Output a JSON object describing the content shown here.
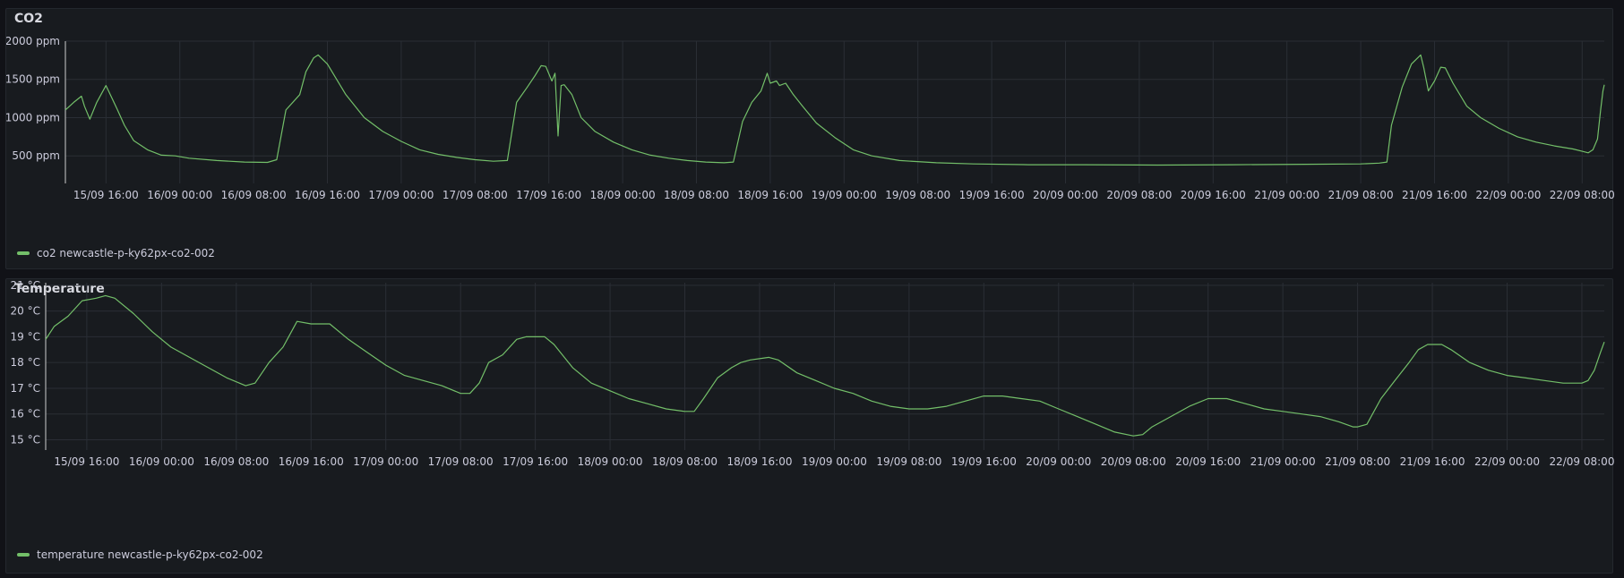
{
  "colors": {
    "series": "#73bf69",
    "grid": "#2a2e35",
    "axis_text": "#ccccdc"
  },
  "panels": {
    "co2": {
      "title": "CO2",
      "legend": "co2 newcastle-p-ky62px-co2-002"
    },
    "temperature": {
      "title": "Temperature",
      "legend": "temperature newcastle-p-ky62px-co2-002"
    }
  },
  "chart_data": [
    {
      "type": "line",
      "title": "CO2",
      "xlabel": "",
      "ylabel": "",
      "ylim": [
        140,
        2000
      ],
      "y_ticks": [
        "500 ppm",
        "1000 ppm",
        "1500 ppm",
        "2000 ppm"
      ],
      "y_tick_values": [
        500,
        1000,
        1500,
        2000
      ],
      "x_range": [
        "15/09 11:36",
        "22/09 10:24"
      ],
      "x_ticks": [
        "15/09 16:00",
        "16/09 00:00",
        "16/09 08:00",
        "16/09 16:00",
        "17/09 00:00",
        "17/09 08:00",
        "17/09 16:00",
        "18/09 00:00",
        "18/09 08:00",
        "18/09 16:00",
        "19/09 00:00",
        "19/09 08:00",
        "19/09 16:00",
        "20/09 00:00",
        "20/09 08:00",
        "20/09 16:00",
        "21/09 00:00",
        "21/09 08:00",
        "21/09 16:00",
        "22/09 00:00",
        "22/09 08:00"
      ],
      "grid": true,
      "legend": "bottom-left",
      "series": [
        {
          "name": "co2 newcastle-p-ky62px-co2-002",
          "points": [
            [
              "15/09 11:36",
              1100
            ],
            [
              "15/09 12:30",
              1200
            ],
            [
              "15/09 13:20",
              1280
            ],
            [
              "15/09 13:40",
              1150
            ],
            [
              "15/09 14:15",
              980
            ],
            [
              "15/09 15:00",
              1200
            ],
            [
              "15/09 16:00",
              1420
            ],
            [
              "15/09 16:40",
              1250
            ],
            [
              "15/09 17:15",
              1100
            ],
            [
              "15/09 18:00",
              900
            ],
            [
              "15/09 19:00",
              700
            ],
            [
              "15/09 20:30",
              580
            ],
            [
              "15/09 22:00",
              510
            ],
            [
              "15/09 23:30",
              500
            ],
            [
              "16/09 01:00",
              470
            ],
            [
              "16/09 04:00",
              440
            ],
            [
              "16/09 07:00",
              420
            ],
            [
              "16/09 09:30",
              415
            ],
            [
              "16/09 10:30",
              450
            ],
            [
              "16/09 11:30",
              1100
            ],
            [
              "16/09 13:00",
              1300
            ],
            [
              "16/09 13:40",
              1600
            ],
            [
              "16/09 14:30",
              1780
            ],
            [
              "16/09 15:00",
              1820
            ],
            [
              "16/09 16:00",
              1700
            ],
            [
              "16/09 17:00",
              1500
            ],
            [
              "16/09 18:00",
              1300
            ],
            [
              "16/09 20:00",
              1000
            ],
            [
              "16/09 22:00",
              820
            ],
            [
              "17/09 00:00",
              690
            ],
            [
              "17/09 02:00",
              580
            ],
            [
              "17/09 04:00",
              520
            ],
            [
              "17/09 06:00",
              480
            ],
            [
              "17/09 08:00",
              450
            ],
            [
              "17/09 10:00",
              430
            ],
            [
              "17/09 11:30",
              440
            ],
            [
              "17/09 12:30",
              1200
            ],
            [
              "17/09 13:40",
              1400
            ],
            [
              "17/09 14:30",
              1550
            ],
            [
              "17/09 15:10",
              1680
            ],
            [
              "17/09 15:40",
              1670
            ],
            [
              "17/09 16:20",
              1480
            ],
            [
              "17/09 16:40",
              1580
            ],
            [
              "17/09 17:00",
              760
            ],
            [
              "17/09 17:20",
              1420
            ],
            [
              "17/09 17:40",
              1430
            ],
            [
              "17/09 18:30",
              1300
            ],
            [
              "17/09 19:30",
              1000
            ],
            [
              "17/09 21:00",
              820
            ],
            [
              "17/09 23:00",
              680
            ],
            [
              "18/09 01:00",
              580
            ],
            [
              "18/09 03:00",
              510
            ],
            [
              "18/09 05:00",
              470
            ],
            [
              "18/09 07:00",
              440
            ],
            [
              "18/09 09:00",
              420
            ],
            [
              "18/09 11:00",
              410
            ],
            [
              "18/09 12:00",
              420
            ],
            [
              "18/09 13:00",
              950
            ],
            [
              "18/09 14:00",
              1200
            ],
            [
              "18/09 15:00",
              1350
            ],
            [
              "18/09 15:40",
              1580
            ],
            [
              "18/09 16:00",
              1450
            ],
            [
              "18/09 16:40",
              1480
            ],
            [
              "18/09 17:00",
              1420
            ],
            [
              "18/09 17:40",
              1450
            ],
            [
              "18/09 18:30",
              1300
            ],
            [
              "18/09 19:30",
              1150
            ],
            [
              "18/09 21:00",
              930
            ],
            [
              "18/09 23:00",
              740
            ],
            [
              "19/09 01:00",
              580
            ],
            [
              "19/09 03:00",
              500
            ],
            [
              "19/09 06:00",
              440
            ],
            [
              "19/09 10:00",
              410
            ],
            [
              "19/09 14:00",
              395
            ],
            [
              "19/09 20:00",
              385
            ],
            [
              "20/09 02:00",
              385
            ],
            [
              "20/09 10:00",
              380
            ],
            [
              "20/09 18:00",
              385
            ],
            [
              "21/09 02:00",
              390
            ],
            [
              "21/09 08:00",
              395
            ],
            [
              "21/09 10:00",
              405
            ],
            [
              "21/09 10:50",
              420
            ],
            [
              "21/09 11:20",
              900
            ],
            [
              "21/09 12:30",
              1400
            ],
            [
              "21/09 13:30",
              1700
            ],
            [
              "21/09 14:30",
              1820
            ],
            [
              "21/09 14:50",
              1650
            ],
            [
              "21/09 15:20",
              1350
            ],
            [
              "21/09 16:00",
              1480
            ],
            [
              "21/09 16:40",
              1660
            ],
            [
              "21/09 17:10",
              1650
            ],
            [
              "21/09 18:00",
              1450
            ],
            [
              "21/09 19:30",
              1150
            ],
            [
              "21/09 21:00",
              1000
            ],
            [
              "21/09 23:00",
              860
            ],
            [
              "22/09 01:00",
              750
            ],
            [
              "22/09 03:00",
              680
            ],
            [
              "22/09 05:00",
              630
            ],
            [
              "22/09 07:00",
              590
            ],
            [
              "22/09 08:00",
              560
            ],
            [
              "22/09 08:40",
              540
            ],
            [
              "22/09 09:10",
              580
            ],
            [
              "22/09 09:40",
              720
            ],
            [
              "22/09 10:00",
              1100
            ],
            [
              "22/09 10:15",
              1350
            ],
            [
              "22/09 10:24",
              1430
            ]
          ]
        }
      ]
    },
    {
      "type": "line",
      "title": "Temperature",
      "xlabel": "",
      "ylabel": "",
      "ylim": [
        14.6,
        21.1
      ],
      "y_ticks": [
        "15 °C",
        "16 °C",
        "17 °C",
        "18 °C",
        "19 °C",
        "20 °C",
        "21 °C"
      ],
      "y_tick_values": [
        15,
        16,
        17,
        18,
        19,
        20,
        21
      ],
      "x_range": [
        "15/09 11:36",
        "22/09 10:24"
      ],
      "x_ticks": [
        "15/09 16:00",
        "16/09 00:00",
        "16/09 08:00",
        "16/09 16:00",
        "17/09 00:00",
        "17/09 08:00",
        "17/09 16:00",
        "18/09 00:00",
        "18/09 08:00",
        "18/09 16:00",
        "19/09 00:00",
        "19/09 08:00",
        "19/09 16:00",
        "20/09 00:00",
        "20/09 08:00",
        "20/09 16:00",
        "21/09 00:00",
        "21/09 08:00",
        "21/09 16:00",
        "22/09 00:00",
        "22/09 08:00"
      ],
      "grid": true,
      "legend": "bottom-left",
      "series": [
        {
          "name": "temperature newcastle-p-ky62px-co2-002",
          "points": [
            [
              "15/09 11:36",
              18.9
            ],
            [
              "15/09 12:30",
              19.4
            ],
            [
              "15/09 14:00",
              19.8
            ],
            [
              "15/09 15:30",
              20.4
            ],
            [
              "15/09 17:00",
              20.5
            ],
            [
              "15/09 18:00",
              20.6
            ],
            [
              "15/09 19:00",
              20.5
            ],
            [
              "15/09 21:00",
              19.9
            ],
            [
              "15/09 23:00",
              19.2
            ],
            [
              "16/09 01:00",
              18.6
            ],
            [
              "16/09 03:00",
              18.2
            ],
            [
              "16/09 05:00",
              17.8
            ],
            [
              "16/09 07:00",
              17.4
            ],
            [
              "16/09 09:00",
              17.1
            ],
            [
              "16/09 10:00",
              17.2
            ],
            [
              "16/09 11:30",
              18.0
            ],
            [
              "16/09 13:00",
              18.6
            ],
            [
              "16/09 14:30",
              19.6
            ],
            [
              "16/09 16:00",
              19.5
            ],
            [
              "16/09 18:00",
              19.5
            ],
            [
              "16/09 20:00",
              18.9
            ],
            [
              "16/09 22:00",
              18.4
            ],
            [
              "17/09 00:00",
              17.9
            ],
            [
              "17/09 02:00",
              17.5
            ],
            [
              "17/09 04:00",
              17.3
            ],
            [
              "17/09 06:00",
              17.1
            ],
            [
              "17/09 08:00",
              16.8
            ],
            [
              "17/09 09:00",
              16.8
            ],
            [
              "17/09 10:00",
              17.2
            ],
            [
              "17/09 11:00",
              18.0
            ],
            [
              "17/09 12:30",
              18.3
            ],
            [
              "17/09 14:00",
              18.9
            ],
            [
              "17/09 15:00",
              19.0
            ],
            [
              "17/09 17:00",
              19.0
            ],
            [
              "17/09 18:00",
              18.7
            ],
            [
              "17/09 20:00",
              17.8
            ],
            [
              "17/09 22:00",
              17.2
            ],
            [
              "18/09 00:00",
              16.9
            ],
            [
              "18/09 02:00",
              16.6
            ],
            [
              "18/09 04:00",
              16.4
            ],
            [
              "18/09 06:00",
              16.2
            ],
            [
              "18/09 08:00",
              16.1
            ],
            [
              "18/09 09:00",
              16.1
            ],
            [
              "18/09 10:00",
              16.6
            ],
            [
              "18/09 11:30",
              17.4
            ],
            [
              "18/09 13:00",
              17.8
            ],
            [
              "18/09 14:00",
              18.0
            ],
            [
              "18/09 15:00",
              18.1
            ],
            [
              "18/09 17:00",
              18.2
            ],
            [
              "18/09 18:00",
              18.1
            ],
            [
              "18/09 20:00",
              17.6
            ],
            [
              "18/09 22:00",
              17.3
            ],
            [
              "19/09 00:00",
              17.0
            ],
            [
              "19/09 02:00",
              16.8
            ],
            [
              "19/09 04:00",
              16.5
            ],
            [
              "19/09 06:00",
              16.3
            ],
            [
              "19/09 08:00",
              16.2
            ],
            [
              "19/09 10:00",
              16.2
            ],
            [
              "19/09 12:00",
              16.3
            ],
            [
              "19/09 14:00",
              16.5
            ],
            [
              "19/09 16:00",
              16.7
            ],
            [
              "19/09 18:00",
              16.7
            ],
            [
              "19/09 20:00",
              16.6
            ],
            [
              "19/09 22:00",
              16.5
            ],
            [
              "20/09 00:00",
              16.2
            ],
            [
              "20/09 02:00",
              15.9
            ],
            [
              "20/09 04:00",
              15.6
            ],
            [
              "20/09 06:00",
              15.3
            ],
            [
              "20/09 08:00",
              15.15
            ],
            [
              "20/09 09:00",
              15.2
            ],
            [
              "20/09 10:00",
              15.5
            ],
            [
              "20/09 12:00",
              15.9
            ],
            [
              "20/09 14:00",
              16.3
            ],
            [
              "20/09 16:00",
              16.6
            ],
            [
              "20/09 18:00",
              16.6
            ],
            [
              "20/09 20:00",
              16.4
            ],
            [
              "20/09 22:00",
              16.2
            ],
            [
              "21/09 00:00",
              16.1
            ],
            [
              "21/09 02:00",
              16.0
            ],
            [
              "21/09 04:00",
              15.9
            ],
            [
              "21/09 06:00",
              15.7
            ],
            [
              "21/09 07:30",
              15.5
            ],
            [
              "21/09 08:00",
              15.5
            ],
            [
              "21/09 09:00",
              15.6
            ],
            [
              "21/09 10:30",
              16.6
            ],
            [
              "21/09 12:00",
              17.3
            ],
            [
              "21/09 13:30",
              18.0
            ],
            [
              "21/09 14:30",
              18.5
            ],
            [
              "21/09 15:30",
              18.7
            ],
            [
              "21/09 17:00",
              18.7
            ],
            [
              "21/09 18:00",
              18.5
            ],
            [
              "21/09 20:00",
              18.0
            ],
            [
              "21/09 22:00",
              17.7
            ],
            [
              "22/09 00:00",
              17.5
            ],
            [
              "22/09 02:00",
              17.4
            ],
            [
              "22/09 04:00",
              17.3
            ],
            [
              "22/09 06:00",
              17.2
            ],
            [
              "22/09 08:00",
              17.2
            ],
            [
              "22/09 08:40",
              17.3
            ],
            [
              "22/09 09:20",
              17.7
            ],
            [
              "22/09 10:00",
              18.4
            ],
            [
              "22/09 10:24",
              18.8
            ]
          ]
        }
      ]
    }
  ]
}
